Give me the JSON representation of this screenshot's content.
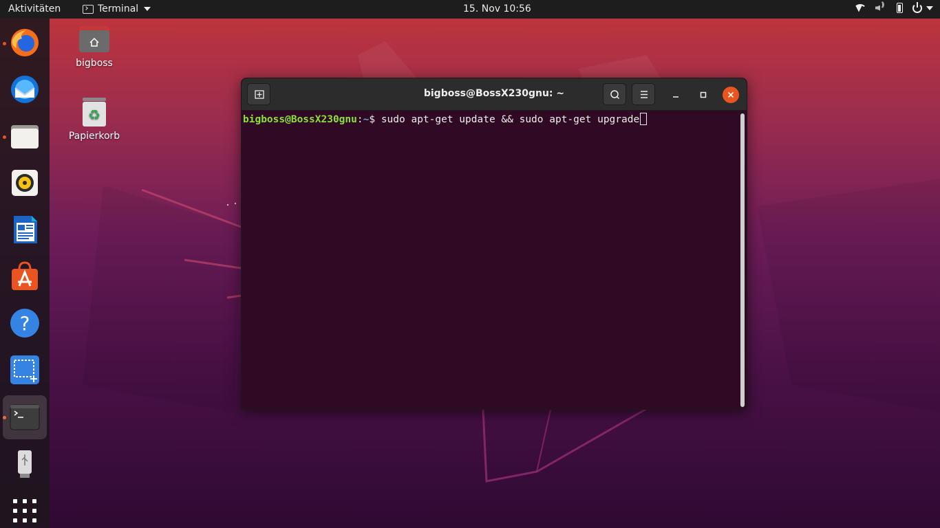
{
  "topbar": {
    "activities": "Aktivitäten",
    "app_name": "Terminal",
    "clock": "15. Nov  10:56"
  },
  "dock": {
    "items": [
      {
        "name": "firefox",
        "running": true
      },
      {
        "name": "thunderbird",
        "running": false
      },
      {
        "name": "files",
        "running": true
      },
      {
        "name": "rhythmbox",
        "running": false
      },
      {
        "name": "libreoffice-writer",
        "running": false
      },
      {
        "name": "ubuntu-software",
        "running": false
      },
      {
        "name": "help",
        "running": false
      },
      {
        "name": "screenshot",
        "running": false
      },
      {
        "name": "terminal",
        "running": true
      },
      {
        "name": "usb-drive",
        "running": false
      },
      {
        "name": "show-applications",
        "running": false
      }
    ]
  },
  "desktop": {
    "home_label": "bigboss",
    "trash_label": "Papierkorb"
  },
  "terminal": {
    "title": "bigboss@BossX230gnu: ~",
    "prompt_user": "bigboss@BossX230gnu",
    "prompt_sep": ":",
    "prompt_path": "~",
    "prompt_symbol": "$ ",
    "command": "sudo apt-get update && sudo apt-get upgrade"
  },
  "colors": {
    "accent": "#e95420",
    "terminal_bg": "#300a24",
    "prompt_user": "#8ae234",
    "prompt_path": "#729fcf"
  }
}
